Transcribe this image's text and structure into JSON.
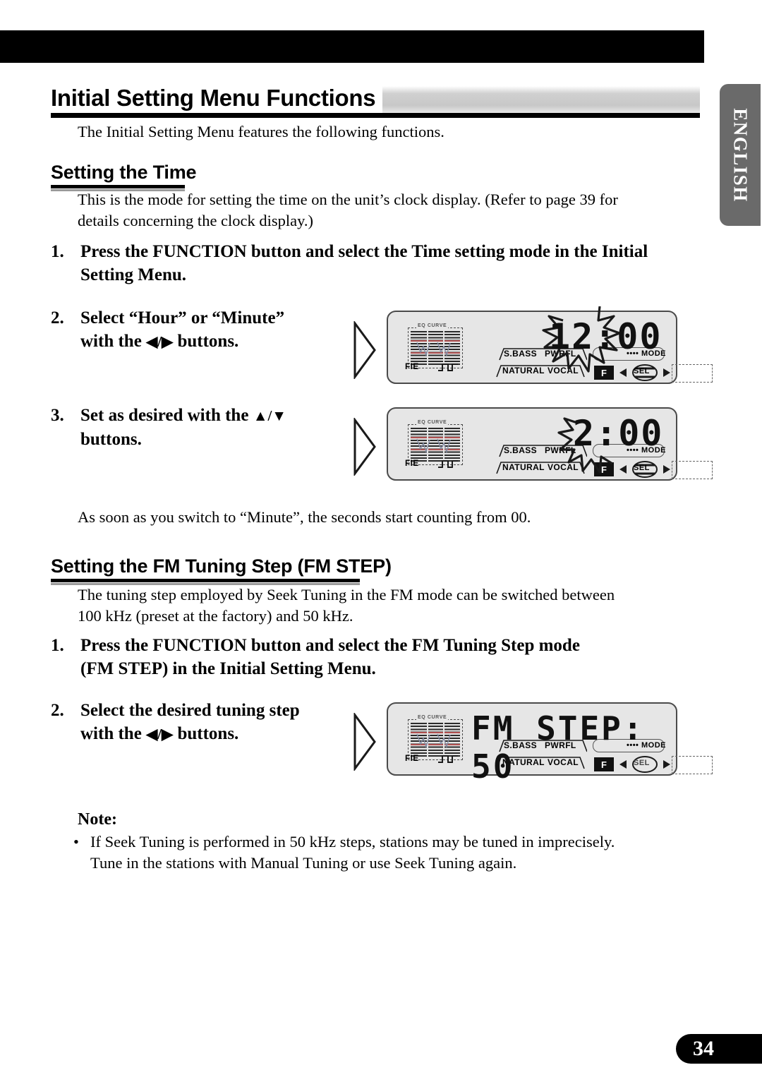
{
  "page": {
    "number": "34",
    "language_tab": "ENGLISH"
  },
  "heading": {
    "title": "Initial Setting Menu Functions",
    "intro": "The Initial Setting Menu features the following functions."
  },
  "sections": [
    {
      "title": "Setting the Time",
      "intro_line1": "This is the mode for setting the time on the unit’s clock display. (Refer to page 39 for",
      "intro_line2": "details concerning the clock display.)",
      "steps": [
        {
          "num": "1.",
          "line1": "Press the FUNCTION button and select the Time setting mode in the Initial",
          "line2": "Setting Menu."
        },
        {
          "num": "2.",
          "line1": "Select “Hour” or “Minute”",
          "line2_prefix": "with the ",
          "line2_arrows": "◀/▶",
          "line2_suffix": " buttons."
        },
        {
          "num": "3.",
          "line1_prefix": "Set as desired with the ",
          "line1_arrows": "▲/▼",
          "line2": "buttons."
        }
      ],
      "after_note": "As soon as you switch to “Minute”, the seconds start counting from 00."
    },
    {
      "title": "Setting the FM Tuning Step (FM STEP)",
      "intro_line1": "The tuning step employed by Seek Tuning in the FM mode can be switched between",
      "intro_line2": "100 kHz (preset at the factory) and 50 kHz.",
      "steps": [
        {
          "num": "1.",
          "line1": "Press the FUNCTION button and select the FM Tuning Step mode",
          "line2": "(FM STEP) in the Initial Setting Menu."
        },
        {
          "num": "2.",
          "line1": "Select the desired tuning step",
          "line2_prefix": "with the ",
          "line2_arrows": "◀/▶",
          "line2_suffix": " buttons."
        }
      ]
    }
  ],
  "note": {
    "title": "Note:",
    "bullet": "•",
    "line1": "If Seek Tuning is performed in 50 kHz steps, stations may be tuned in imprecisely.",
    "line2": "Tune in the stations with Manual Tuning or use Seek Tuning again."
  },
  "displays": [
    {
      "id": "display-time-hour",
      "readout": "12:00",
      "flash_part": "12:0",
      "eq_label": "EQ CURVE",
      "fie_label": "FIE",
      "tag_sbass": "S.BASS",
      "tag_pwrfl": "PWRFL",
      "tag_natural": "NATURAL",
      "tag_vocal": "VOCAL",
      "mode_label": "MODE",
      "mode_dots": "••••",
      "f_indicator": "F",
      "sel_label": "SEL"
    },
    {
      "id": "display-time-set",
      "readout": "2:00",
      "flash_part": "2",
      "eq_label": "EQ CURVE",
      "fie_label": "FIE",
      "tag_sbass": "S.BASS",
      "tag_pwrfl": "PWRFL",
      "tag_natural": "NATURAL",
      "tag_vocal": "VOCAL",
      "mode_label": "MODE",
      "mode_dots": "••••",
      "f_indicator": "F",
      "sel_label": "SEL"
    },
    {
      "id": "display-fm-step",
      "readout": "FM STEP: 50",
      "eq_label": "EQ CURVE",
      "fie_label": "FIE",
      "tag_sbass": "S.BASS",
      "tag_pwrfl": "PWRFL",
      "tag_natural": "NATURAL",
      "tag_vocal": "VOCAL",
      "mode_label": "MODE",
      "mode_dots": "••••",
      "f_indicator": "F",
      "sel_label": "SEL"
    }
  ]
}
